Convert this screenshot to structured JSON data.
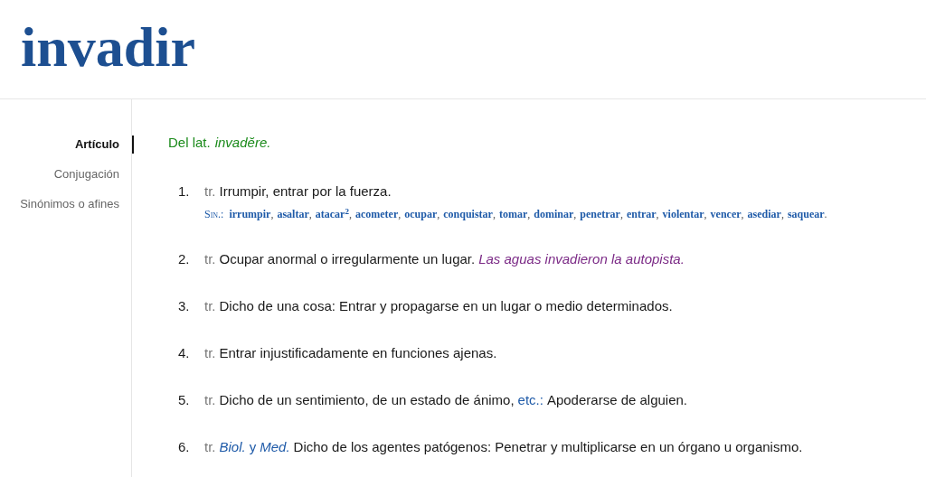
{
  "title": "invadir",
  "nav": [
    {
      "label": "Artículo",
      "selected": true
    },
    {
      "label": "Conjugación",
      "selected": false
    },
    {
      "label": "Sinónimos o afines",
      "selected": false
    }
  ],
  "etymology": {
    "text": "Del lat.",
    "word": "invadĕre."
  },
  "definitions": [
    {
      "number": "1.",
      "category": "tr.",
      "segments": [
        {
          "kind": "text",
          "text": "Irrumpir, entrar por la fuerza."
        }
      ],
      "synonyms": {
        "label": "Sin.:",
        "separator": ",",
        "end": ".",
        "words": [
          "irrumpir",
          "asaltar",
          "atacar$^{2}$",
          "acometer",
          "ocupar",
          "conquistar",
          "tomar",
          "dominar",
          "penetrar",
          "entrar",
          "violentar",
          "vencer",
          "asediar",
          "saquear"
        ]
      }
    },
    {
      "number": "2.",
      "category": "tr.",
      "segments": [
        {
          "kind": "text",
          "text": "Ocupar anormal o irregularmente un lugar."
        },
        {
          "kind": "example",
          "text": "Las aguas invadieron la autopista."
        }
      ]
    },
    {
      "number": "3.",
      "category": "tr.",
      "segments": [
        {
          "kind": "text",
          "text": "Dicho de una cosa: Entrar y propagarse en un lugar o medio determinados."
        }
      ]
    },
    {
      "number": "4.",
      "category": "tr.",
      "segments": [
        {
          "kind": "text",
          "text": "Entrar injustificadamente en funciones ajenas."
        }
      ]
    },
    {
      "number": "5.",
      "category": "tr.",
      "segments": [
        {
          "kind": "text",
          "text": "Dicho de un sentimiento, de un estado de ánimo,"
        },
        {
          "kind": "abbr",
          "text": "etc.:"
        },
        {
          "kind": "text",
          "text": "Apoderarse de alguien."
        }
      ]
    },
    {
      "number": "6.",
      "category": "tr.",
      "segments": [
        {
          "kind": "field",
          "text": "Biol."
        },
        {
          "kind": "abbr",
          "text": "y"
        },
        {
          "kind": "field",
          "text": "Med."
        },
        {
          "kind": "text",
          "text": "Dicho de los agentes patógenos: Penetrar y multiplicarse en un órgano u organismo."
        }
      ]
    }
  ]
}
